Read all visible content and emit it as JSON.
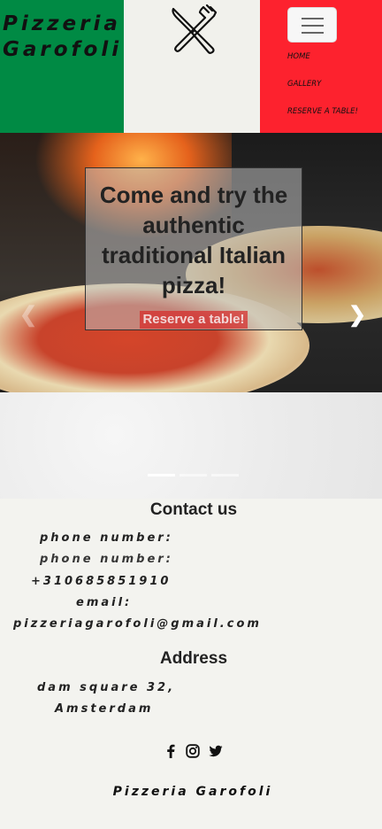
{
  "header": {
    "brand_line1": "Pizzeria",
    "brand_line2": "Garofoli",
    "logo_icon": "crossed-knife-fork-icon",
    "menu_icon": "hamburger-icon",
    "colors": {
      "green": "#008a44",
      "white": "#f1f1ec",
      "red": "#fd222e"
    }
  },
  "nav": {
    "items": [
      {
        "label": "HOME"
      },
      {
        "label": "GALLERY"
      },
      {
        "label": "RESERVE A TABLE!"
      }
    ]
  },
  "carousel": {
    "caption_title": "Come and try the authentic traditional Italian pizza!",
    "cta_label": "Reserve a table!",
    "prev_icon": "chevron-left-icon",
    "next_icon": "chevron-right-icon",
    "slide_count": 3,
    "active_slide": 1
  },
  "contact": {
    "title": "Contact us",
    "phone_label": "phone number:",
    "phone_label_repeat": "phone number:",
    "phone_value": "+310685851910",
    "email_label": "email:",
    "email_value": "pizzeriagarofoli@gmail.com"
  },
  "address": {
    "title": "Address",
    "line1": "dam square 32,",
    "line2": "Amsterdam"
  },
  "social": {
    "icons": [
      "facebook-icon",
      "instagram-icon",
      "twitter-icon"
    ]
  },
  "footer": {
    "brand": "Pizzeria Garofoli"
  }
}
